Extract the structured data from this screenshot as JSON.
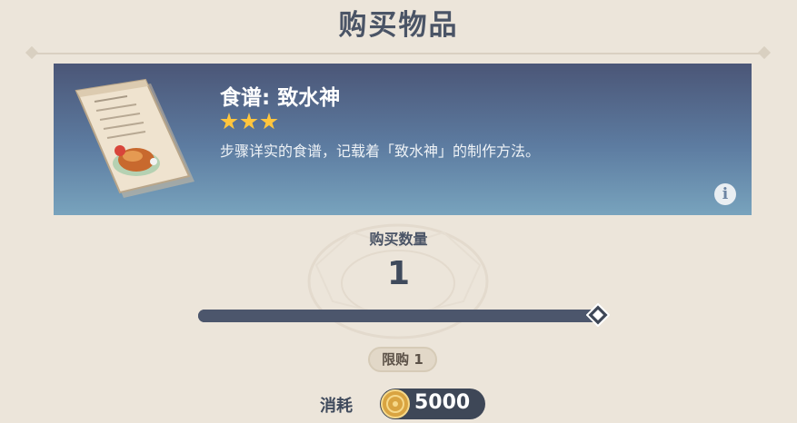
{
  "dialog": {
    "title": "购买物品"
  },
  "item": {
    "name": "食谱: 致水神",
    "rarity_stars": 3,
    "description": "步骤详实的食谱，记载着「致水神」的制作方法。",
    "icon": "recipe-scroll-icon",
    "info_icon": "info-icon",
    "colors": {
      "star": "#ffc53d",
      "banner_top": "#4b5677",
      "banner_bottom": "#78a3bd"
    }
  },
  "quantity": {
    "label": "购买数量",
    "value": "1",
    "slider_fraction": 1.0
  },
  "limit": {
    "label": "限购 1"
  },
  "cost": {
    "label": "消耗",
    "currency_icon": "mora-coin-icon",
    "amount": "5000"
  }
}
